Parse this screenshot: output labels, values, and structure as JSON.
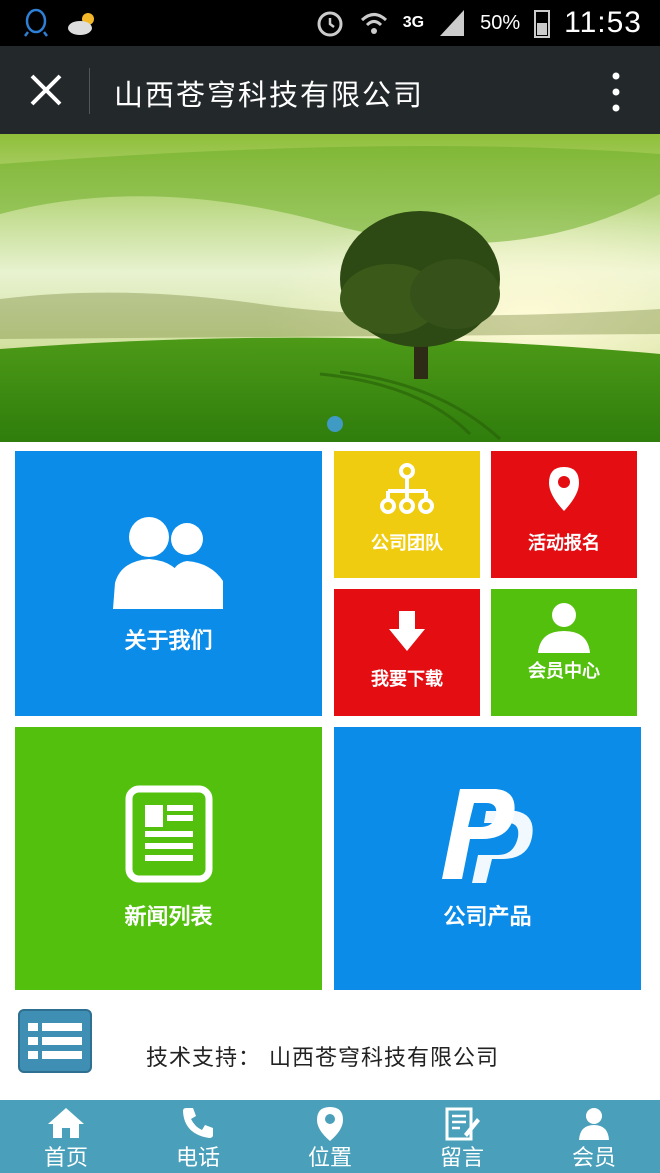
{
  "status_bar": {
    "network": "3G",
    "battery": "50%",
    "time": "11:53"
  },
  "header": {
    "title": "山西苍穹科技有限公司"
  },
  "tiles": {
    "about": "关于我们",
    "team": "公司团队",
    "event": "活动报名",
    "download": "我要下载",
    "member_center": "会员中心",
    "news": "新闻列表",
    "products": "公司产品"
  },
  "colors": {
    "blue": "#0b8ce8",
    "yellow": "#f0cc10",
    "red": "#e30d12",
    "green": "#52c00c",
    "nav": "#4aa0ba",
    "header": "#23282b"
  },
  "footer": {
    "support": "技术支持： 山西苍穹科技有限公司"
  },
  "bottom_nav": {
    "items": [
      "首页",
      "电话",
      "位置",
      "留言",
      "会员"
    ]
  }
}
